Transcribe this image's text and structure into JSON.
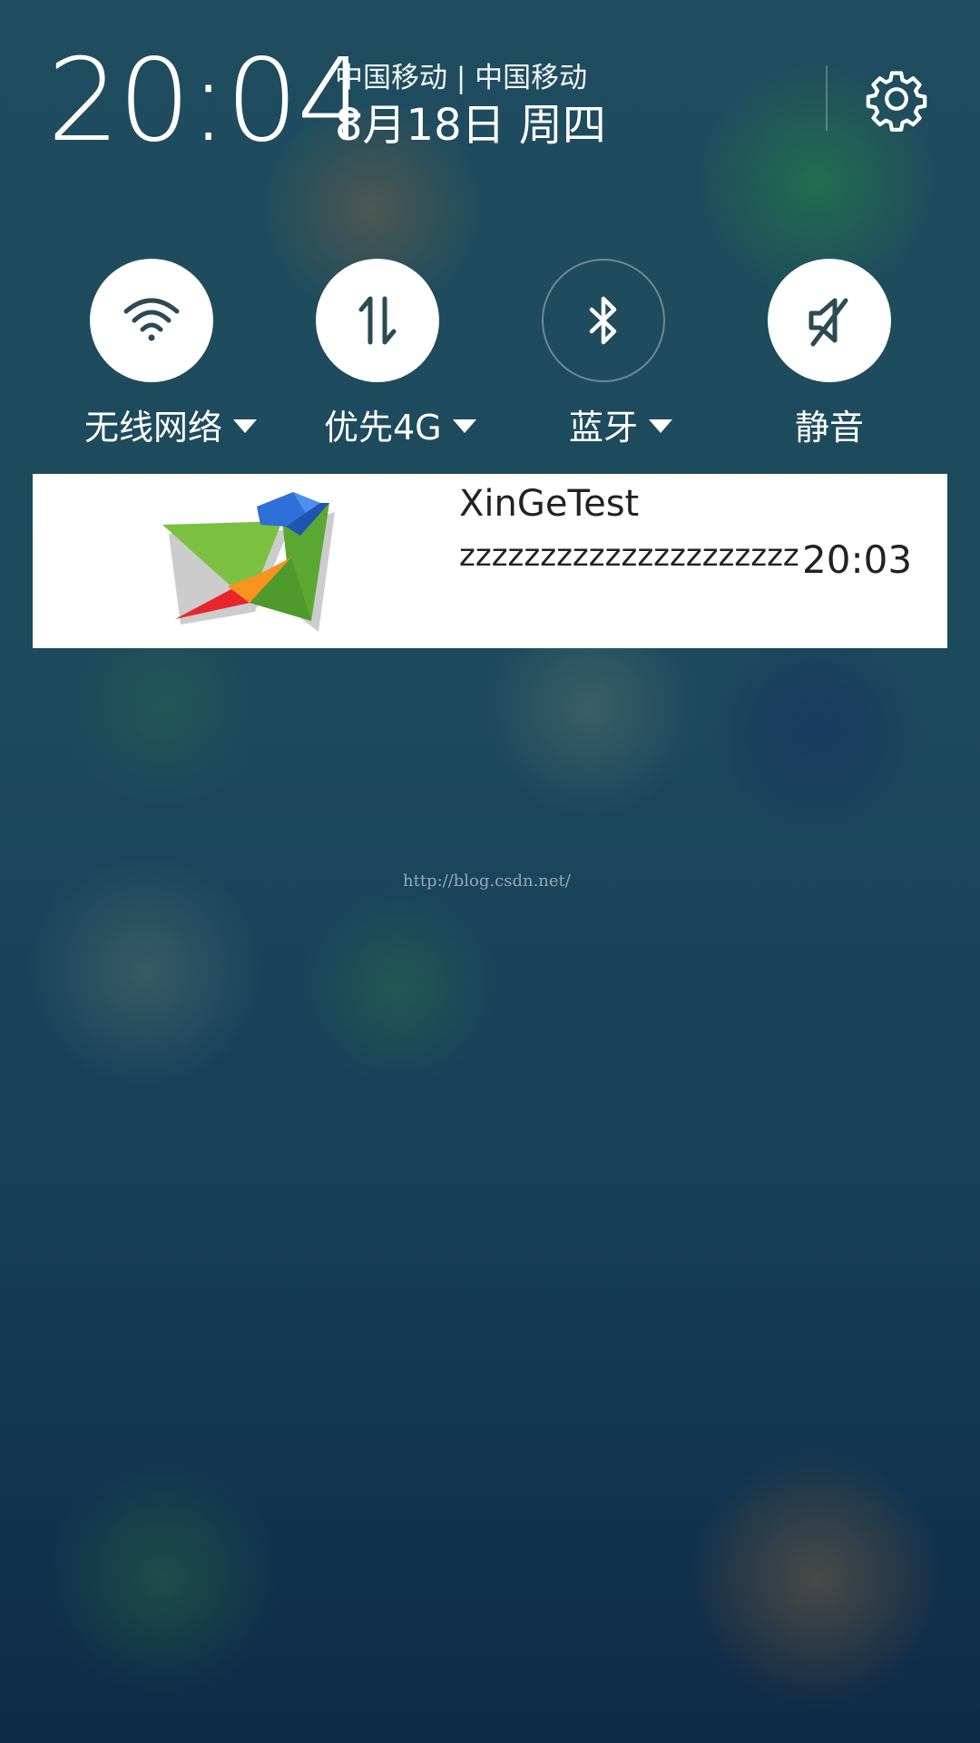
{
  "header": {
    "time": "20:04",
    "carrier": "中国移动 | 中国移动",
    "date": "8月18日 周四",
    "settings_icon": "gear-icon"
  },
  "toggles": [
    {
      "label": "无线网络",
      "icon": "wifi-icon",
      "state": "on",
      "has_dropdown": true
    },
    {
      "label": "优先4G",
      "icon": "data-transfer-icon",
      "state": "on",
      "has_dropdown": true
    },
    {
      "label": "蓝牙",
      "icon": "bluetooth-icon",
      "state": "off",
      "has_dropdown": true
    },
    {
      "label": "静音",
      "icon": "mute-icon",
      "state": "on",
      "has_dropdown": false
    }
  ],
  "notification": {
    "app_icon": "xinge-bird-logo",
    "title": "XinGeTest",
    "body": "zzzzzzzzzzzzzzzzzzzzz",
    "time": "20:03"
  },
  "watermark": "http://blog.csdn.net/",
  "colors": {
    "toggle_icon": "#2c4a52",
    "notification_bg": "#ffffff"
  }
}
